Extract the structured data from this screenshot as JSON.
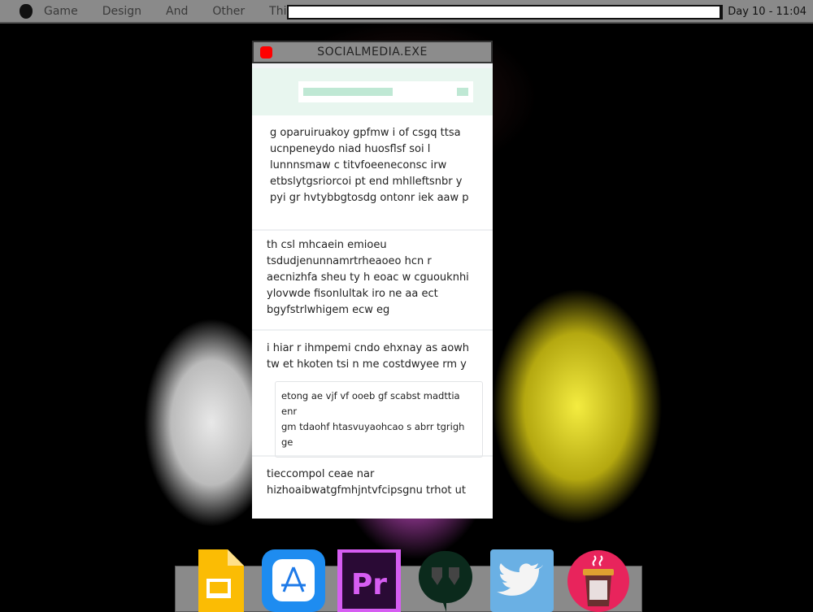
{
  "menubar": {
    "items": [
      "Game",
      "Design",
      "And",
      "Other",
      "Things"
    ],
    "search_value": "",
    "clock": "Day 10 - 11:04"
  },
  "window": {
    "title": "SOCIALMEDIA.EXE",
    "posts": [
      {
        "lines": [
          " g oparuiruakoy gpfmw i of csgq ttsa",
          "ucnpeneydo niad  huosflsf soi l",
          "lunnnsmaw c titvfoeeneconsc irw",
          "etbslytgsriorcoi pt  end mhlleftsnbr y",
          "pyi gr hvtybbgtosdg ontonr iek aaw p"
        ]
      },
      {
        "lines": [
          "th csl mhcaein  emioeu",
          "tsdudjenunnamrtrheaoeo hcn r",
          "aecnizhfa sheu  ty h eoac w cguouknhi",
          "ylovwde fisonlultak iro ne aa ect",
          "bgyfstrlwhigem ecw eg"
        ]
      },
      {
        "lines": [
          "i hiar r  ihmpemi cndo ehxnay as aowh",
          "tw et hkoten tsi n me costdwyee rm y"
        ],
        "quote": [
          "etong ae vjf vf ooeb gf scabst madttia enr",
          "gm tdaohf htasvuyaohcao s  abrr tgrigh ge"
        ]
      },
      {
        "lines": [
          "tieccompol ceae nar",
          "hizhoaibwatgfmhjntvfcipsgnu trhot ut"
        ]
      }
    ]
  },
  "dock": {
    "icons": [
      "slides-icon",
      "app-store-icon",
      "premiere-pro-icon",
      "hangouts-icon",
      "twitter-icon",
      "coffee-icon"
    ],
    "premiere_label": "Pr"
  },
  "colors": {
    "close": "#ff0000",
    "header": "#e8f6ef"
  }
}
